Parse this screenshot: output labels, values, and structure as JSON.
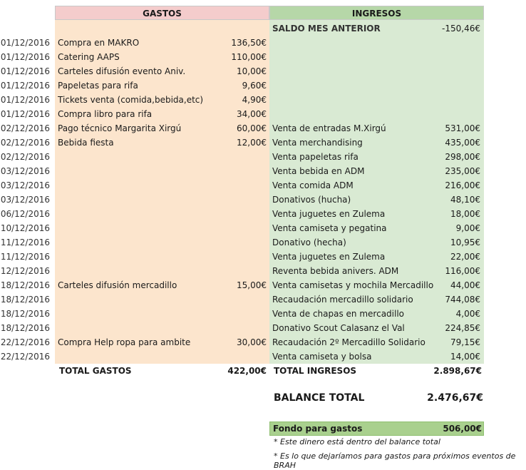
{
  "headers": {
    "gastos": "GASTOS",
    "ingresos": "INGRESOS"
  },
  "saldo": {
    "label": "SALDO MES ANTERIOR",
    "amount": "-150,46€"
  },
  "rows": [
    {
      "date": "01/12/2016",
      "gasto": "Compra en MAKRO",
      "gasto_amt": "136,50€",
      "ingreso": "",
      "ingreso_amt": ""
    },
    {
      "date": "01/12/2016",
      "gasto": "Catering AAPS",
      "gasto_amt": "110,00€",
      "ingreso": "",
      "ingreso_amt": ""
    },
    {
      "date": "01/12/2016",
      "gasto": "Carteles difusión evento Aniv.",
      "gasto_amt": "10,00€",
      "ingreso": "",
      "ingreso_amt": ""
    },
    {
      "date": "01/12/2016",
      "gasto": "Papeletas para rifa",
      "gasto_amt": "9,60€",
      "ingreso": "",
      "ingreso_amt": ""
    },
    {
      "date": "01/12/2016",
      "gasto": "Tickets venta (comida,bebida,etc)",
      "gasto_amt": "4,90€",
      "ingreso": "",
      "ingreso_amt": ""
    },
    {
      "date": "01/12/2016",
      "gasto": "Compra libro para rifa",
      "gasto_amt": "34,00€",
      "ingreso": "",
      "ingreso_amt": ""
    },
    {
      "date": "02/12/2016",
      "gasto": "Pago técnico Margarita Xirgú",
      "gasto_amt": "60,00€",
      "ingreso": "Venta de entradas M.Xirgú",
      "ingreso_amt": "531,00€"
    },
    {
      "date": "02/12/2016",
      "gasto": "Bebida fiesta",
      "gasto_amt": "12,00€",
      "ingreso": "Venta merchandising",
      "ingreso_amt": "435,00€"
    },
    {
      "date": "02/12/2016",
      "gasto": "",
      "gasto_amt": "",
      "ingreso": "Venta papeletas rifa",
      "ingreso_amt": "298,00€"
    },
    {
      "date": "03/12/2016",
      "gasto": "",
      "gasto_amt": "",
      "ingreso": "Venta bebida en ADM",
      "ingreso_amt": "235,00€"
    },
    {
      "date": "03/12/2016",
      "gasto": "",
      "gasto_amt": "",
      "ingreso": "Venta comida ADM",
      "ingreso_amt": "216,00€"
    },
    {
      "date": "03/12/2016",
      "gasto": "",
      "gasto_amt": "",
      "ingreso": "Donativos (hucha)",
      "ingreso_amt": "48,10€"
    },
    {
      "date": "06/12/2016",
      "gasto": "",
      "gasto_amt": "",
      "ingreso": "Venta juguetes en Zulema",
      "ingreso_amt": "18,00€"
    },
    {
      "date": "10/12/2016",
      "gasto": "",
      "gasto_amt": "",
      "ingreso": "Venta camiseta y pegatina",
      "ingreso_amt": "9,00€"
    },
    {
      "date": "11/12/2016",
      "gasto": "",
      "gasto_amt": "",
      "ingreso": "Donativo (hecha)",
      "ingreso_amt": "10,95€"
    },
    {
      "date": "11/12/2016",
      "gasto": "",
      "gasto_amt": "",
      "ingreso": "Venta juguetes en Zulema",
      "ingreso_amt": "22,00€"
    },
    {
      "date": "12/12/2016",
      "gasto": "",
      "gasto_amt": "",
      "ingreso": "Reventa bebida anivers. ADM",
      "ingreso_amt": "116,00€"
    },
    {
      "date": "18/12/2016",
      "gasto": "Carteles difusión mercadillo",
      "gasto_amt": "15,00€",
      "ingreso": "Venta camisetas y mochila Mercadillo",
      "ingreso_amt": "44,00€"
    },
    {
      "date": "18/12/2016",
      "gasto": "",
      "gasto_amt": "",
      "ingreso": "Recaudación mercadillo solidario",
      "ingreso_amt": "744,08€"
    },
    {
      "date": "18/12/2016",
      "gasto": "",
      "gasto_amt": "",
      "ingreso": "Venta de chapas en mercadillo",
      "ingreso_amt": "4,00€"
    },
    {
      "date": "18/12/2016",
      "gasto": "",
      "gasto_amt": "",
      "ingreso": "Donativo Scout Calasanz el Val",
      "ingreso_amt": "224,85€"
    },
    {
      "date": "22/12/2016",
      "gasto": "Compra Help ropa para ambite",
      "gasto_amt": "30,00€",
      "ingreso": "Recaudación 2º Mercadillo Solidario",
      "ingreso_amt": "79,15€"
    },
    {
      "date": "22/12/2016",
      "gasto": "",
      "gasto_amt": "",
      "ingreso": "Venta camiseta y bolsa",
      "ingreso_amt": "14,00€"
    }
  ],
  "totals": {
    "gastos_label": "TOTAL GASTOS",
    "gastos_amt": "422,00€",
    "ingresos_label": "TOTAL INGRESOS",
    "ingresos_amt": "2.898,67€"
  },
  "balance": {
    "label": "BALANCE TOTAL",
    "amount": "2.476,67€"
  },
  "fondo": {
    "label": "Fondo para gastos",
    "amount": "506,00€"
  },
  "notes": [
    "* Este dinero está dentro del balance total",
    "* Es lo que dejaríamos para gastos para próximos eventos de BRAH"
  ]
}
